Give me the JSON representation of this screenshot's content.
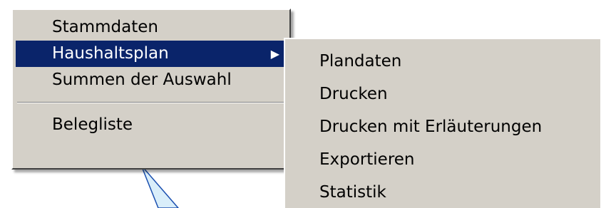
{
  "main_menu": {
    "items": [
      {
        "label": "Stammdaten"
      },
      {
        "label": "Haushaltsplan",
        "submenu_arrow": "▶",
        "selected": true
      },
      {
        "label": "Summen der Auswahl"
      },
      {
        "label": "Belegliste"
      }
    ]
  },
  "submenu": {
    "items": [
      {
        "label": "Plandaten"
      },
      {
        "label": "Drucken"
      },
      {
        "label": "Drucken mit Erläuterungen"
      },
      {
        "label": "Exportieren"
      },
      {
        "label": "Statistik"
      }
    ]
  },
  "colors": {
    "menu_bg": "#d4d0c8",
    "highlight": "#0a246a",
    "callout_fill": "#d9eefa",
    "callout_stroke": "#1a4fb0"
  }
}
